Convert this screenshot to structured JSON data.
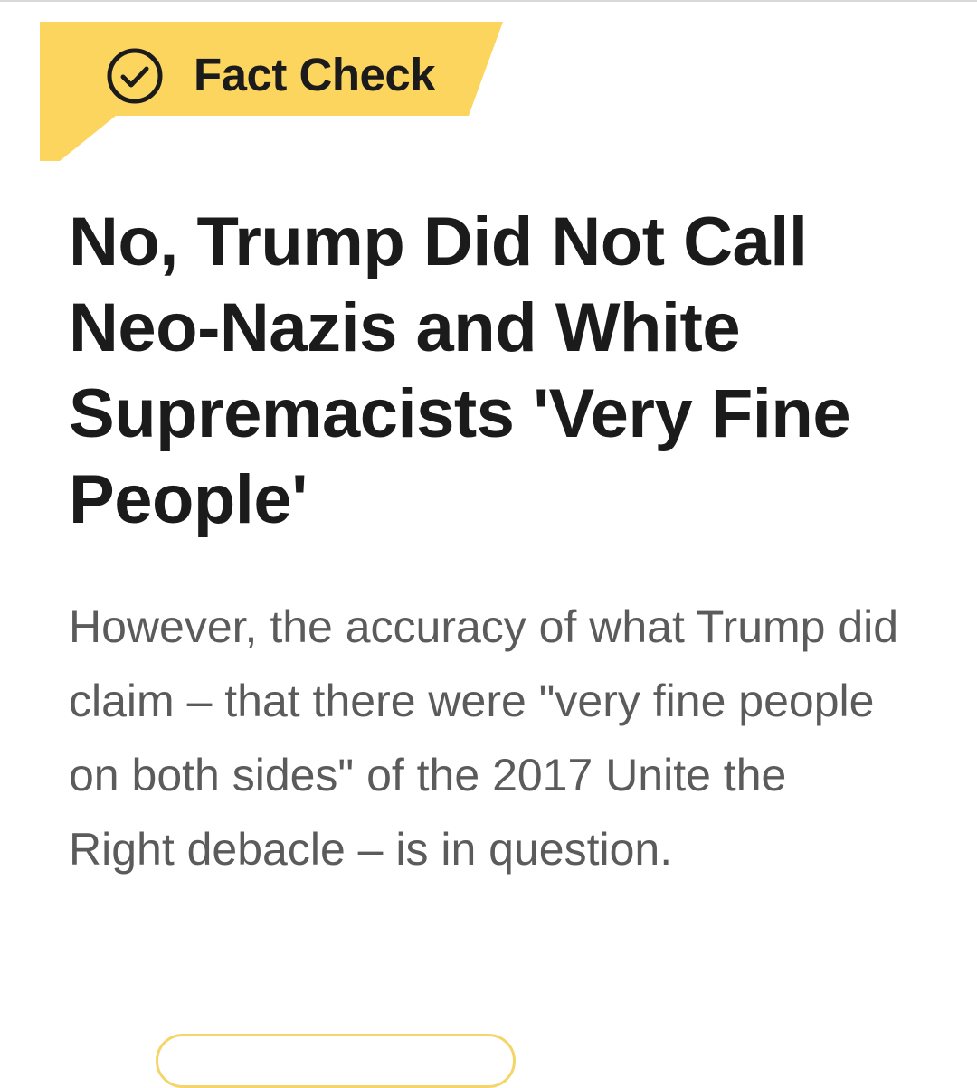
{
  "banner": {
    "label": "Fact Check",
    "icon": "check-circle-icon",
    "color": "#fcd55f"
  },
  "article": {
    "headline": "No, Trump Did Not Call Neo-Nazis and White Supremacists 'Very Fine People'",
    "summary": "However, the accuracy of what Trump did claim – that there were \"very fine people on both sides\" of the 2017 Unite the Right debacle – is in question."
  },
  "colors": {
    "headline": "#1b1b1b",
    "summary": "#5b5b5b",
    "accent": "#fcd55f"
  }
}
